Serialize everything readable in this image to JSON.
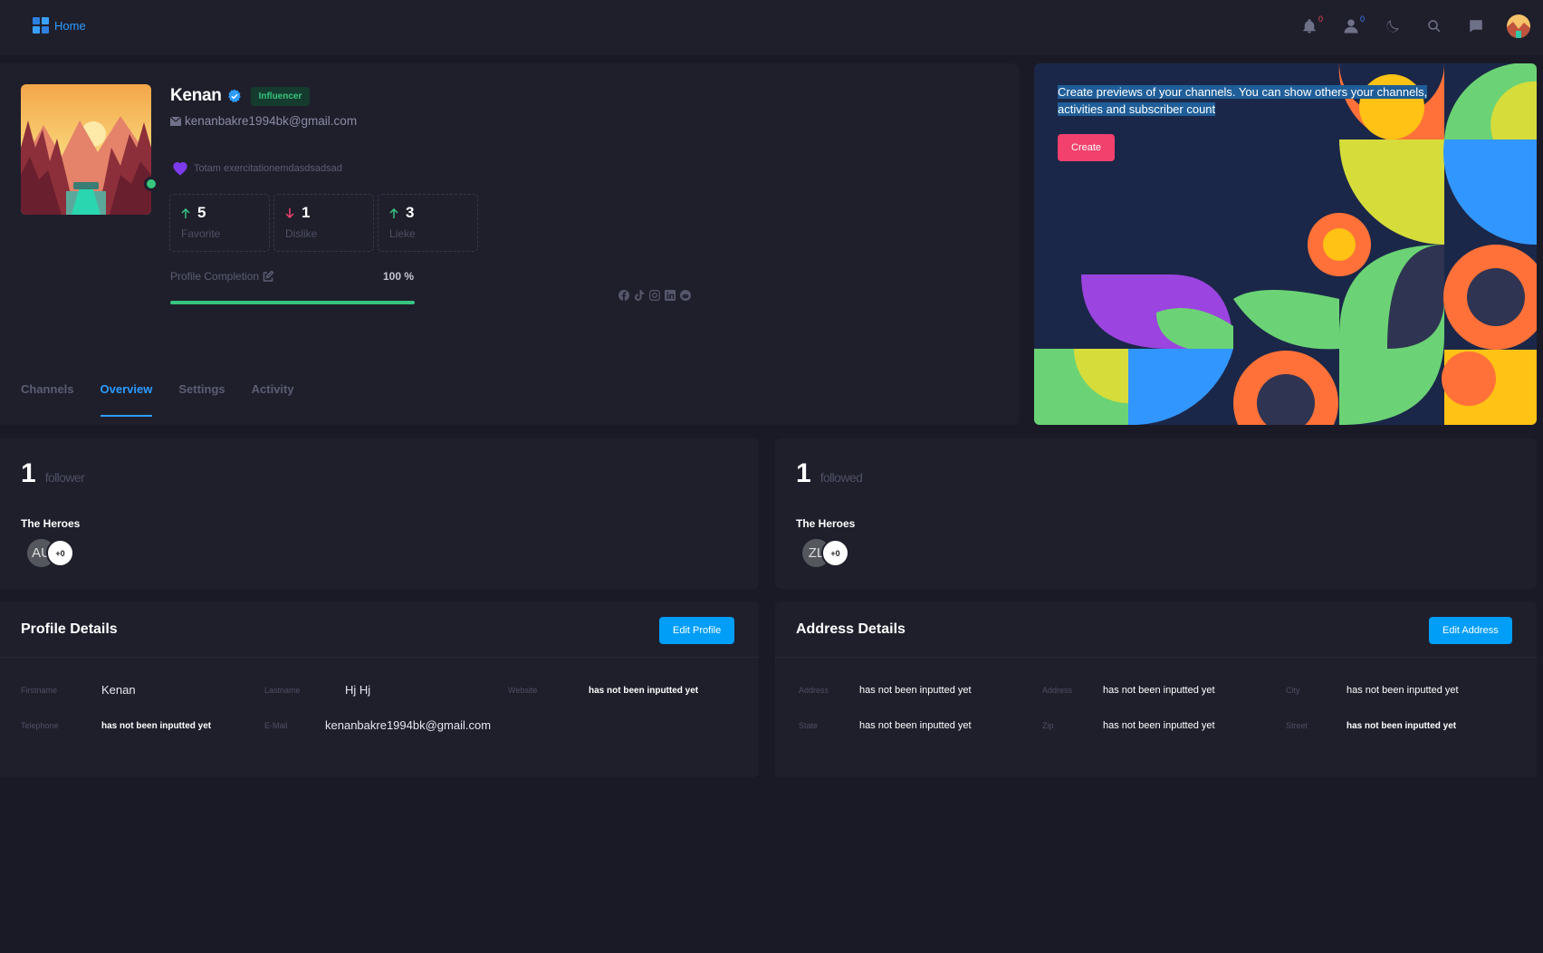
{
  "topbar": {
    "home_label": "Home",
    "notifications_count": "0",
    "users_count": "0"
  },
  "profile": {
    "name": "Kenan",
    "badge": "Influencer",
    "email": "kenanbakre1994bk@gmail.com",
    "bio": "Totam exercitationemdasdsadsad",
    "stats": [
      {
        "value": "5",
        "label": "Favorite",
        "direction": "up"
      },
      {
        "value": "1",
        "label": "Dislike",
        "direction": "down"
      },
      {
        "value": "3",
        "label": "Lieke",
        "direction": "up"
      }
    ],
    "completion_label": "Profile Completion",
    "completion_value": "100 %",
    "completion_fraction": 1.0,
    "socials": [
      "facebook-icon",
      "tiktok-icon",
      "instagram-icon",
      "linkedin-icon",
      "reddit-icon"
    ],
    "tabs": [
      {
        "label": "Channels",
        "active": false
      },
      {
        "label": "Overview",
        "active": true
      },
      {
        "label": "Settings",
        "active": false
      },
      {
        "label": "Activity",
        "active": false
      }
    ]
  },
  "banner": {
    "text": "Create previews of your channels. You can show others your channels, activities and subscriber count",
    "button": "Create"
  },
  "followers": {
    "count": "1",
    "label": "follower",
    "group": "The Heroes",
    "avatar_initials": "AU",
    "more": "+0"
  },
  "followed": {
    "count": "1",
    "label": "followed",
    "group": "The Heroes",
    "avatar_initials": "ZL",
    "more": "+0"
  },
  "profile_details": {
    "title": "Profile Details",
    "button": "Edit Profile",
    "fields": {
      "firstname_label": "Firstname",
      "firstname_value": "Kenan",
      "lastname_label": "Lastname",
      "lastname_value": "Hj Hj",
      "website_label": "Website",
      "website_value": "has not been inputted yet",
      "telephone_label": "Telephone",
      "telephone_value": "has not been inputted yet",
      "email_label": "E-Mail",
      "email_value": "kenanbakre1994bk@gmail.com"
    }
  },
  "address_details": {
    "title": "Address Details",
    "button": "Edit Address",
    "fields": {
      "address1_label": "Address",
      "address1_value": "has not been inputted yet",
      "address2_label": "Address",
      "address2_value": "has not been inputted yet",
      "city_label": "City",
      "city_value": "has not been inputted yet",
      "state_label": "State",
      "state_value": "has not been inputted yet",
      "zip_label": "Zip",
      "zip_value": "has not been inputted yet",
      "street_label": "Street",
      "street_value": "has not been inputted yet"
    }
  },
  "colors": {
    "accent": "#2d9cff",
    "success": "#37c47f",
    "danger": "#f1416c",
    "primary_button": "#009ef7"
  }
}
